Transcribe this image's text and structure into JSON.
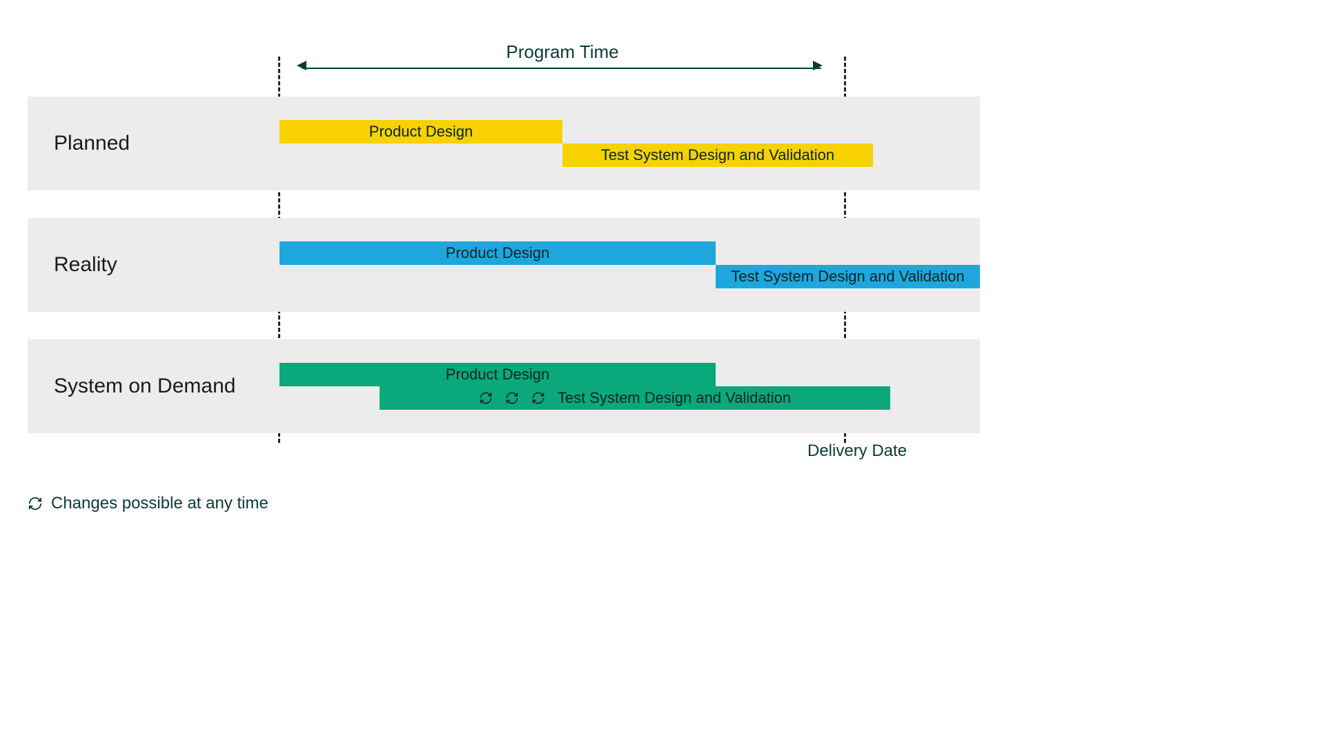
{
  "axis_label": "Program Time",
  "delivery_label": "Delivery Date",
  "legend_text": "Changes possible at any time",
  "rows": {
    "planned": {
      "label": "Planned",
      "pd": "Product Design",
      "ts": "Test System Design and Validation"
    },
    "reality": {
      "label": "Reality",
      "pd": "Product Design",
      "ts": "Test System Design and Validation"
    },
    "sod": {
      "label": "System on Demand",
      "pd": "Product Design",
      "ts": "Test System Design and Validation"
    }
  },
  "colors": {
    "planned": "#f7d100",
    "reality": "#1ea6dd",
    "sod": "#0aa87a",
    "bg_row": "#ececec",
    "text": "#0b3a36"
  },
  "chart_data": {
    "type": "bar",
    "title": "Program Time",
    "xlabel": "Program Time",
    "ylabel": "",
    "xlim": [
      0,
      100
    ],
    "x_markers": {
      "program_start": 0,
      "delivery_date": 100
    },
    "series": [
      {
        "name": "Planned",
        "color": "#f7d100",
        "bars": [
          {
            "label": "Product Design",
            "start": 0,
            "end": 50
          },
          {
            "label": "Test System Design and Validation",
            "start": 50,
            "end": 100
          }
        ]
      },
      {
        "name": "Reality",
        "color": "#1ea6dd",
        "bars": [
          {
            "label": "Product Design",
            "start": 0,
            "end": 77
          },
          {
            "label": "Test System Design and Validation",
            "start": 77,
            "end": 124
          }
        ]
      },
      {
        "name": "System on Demand",
        "color": "#0aa87a",
        "bars": [
          {
            "label": "Product Design",
            "start": 0,
            "end": 77
          },
          {
            "label": "Test System Design and Validation",
            "start": 18,
            "end": 104,
            "note": "Changes possible at any time"
          }
        ]
      }
    ]
  }
}
